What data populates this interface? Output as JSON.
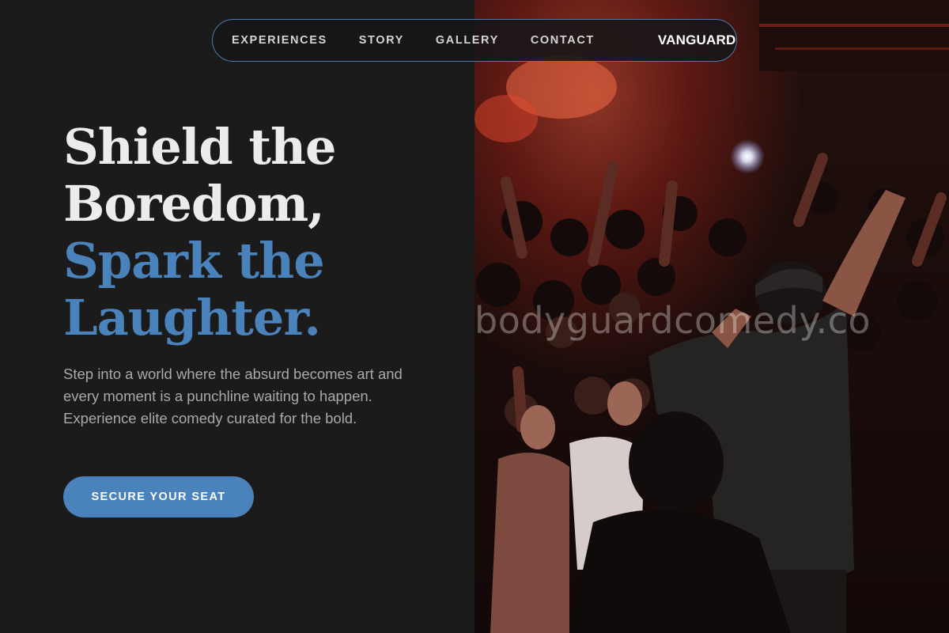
{
  "nav": {
    "links": [
      "EXPERIENCES",
      "STORY",
      "GALLERY",
      "CONTACT"
    ],
    "brand": "VANGUARD"
  },
  "hero": {
    "title_lines": [
      "Shield the",
      "Boredom,"
    ],
    "accent_lines": [
      "Spark the",
      "Laughter."
    ],
    "subtitle": "Step into a world where the absurd becomes art and every moment is a punchline waiting to happen. Experience elite comedy curated for the bold.",
    "cta_label": "SECURE YOUR SEAT"
  },
  "photo": {
    "watermark": "bodyguardcomedy.co",
    "description_icon": "concert-crowd-photo"
  },
  "colors": {
    "background": "#1b1b1c",
    "accent": "#4a82bc",
    "nav_border": "#4c78a8",
    "title_light": "#ececec",
    "subtitle": "#a9a9a9"
  }
}
